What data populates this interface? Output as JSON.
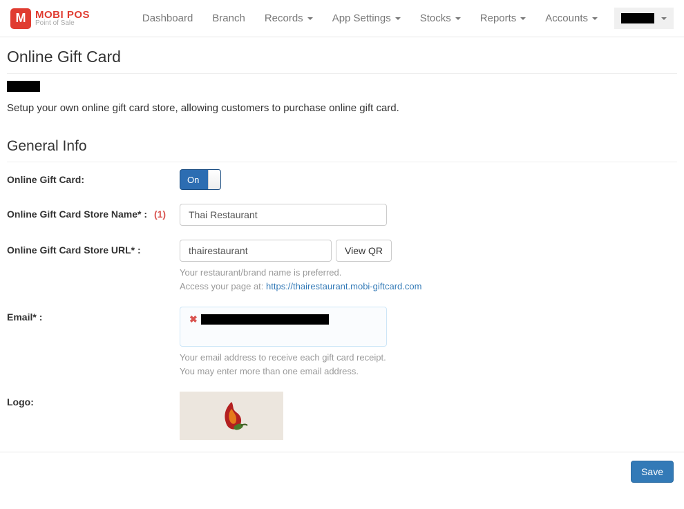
{
  "nav": {
    "logo_title": "MOBI POS",
    "logo_subtitle": "Point of Sale",
    "items": [
      {
        "label": "Dashboard",
        "dropdown": false
      },
      {
        "label": "Branch",
        "dropdown": false
      },
      {
        "label": "Records",
        "dropdown": true
      },
      {
        "label": "App Settings",
        "dropdown": true
      },
      {
        "label": "Stocks",
        "dropdown": true
      },
      {
        "label": "Reports",
        "dropdown": true
      },
      {
        "label": "Accounts",
        "dropdown": true
      }
    ]
  },
  "page": {
    "title": "Online Gift Card",
    "description": "Setup your own online gift card store, allowing customers to purchase online gift card.",
    "section_title": "General Info"
  },
  "form": {
    "toggle": {
      "label": "Online Gift Card:",
      "state": "On"
    },
    "store_name": {
      "label": "Online Gift Card Store Name* :",
      "annotation": "(1)",
      "value": "Thai Restaurant"
    },
    "store_url": {
      "label": "Online Gift Card Store URL* :",
      "value": "thairestaurant",
      "button": "View QR",
      "help_line1": "Your restaurant/brand name is preferred.",
      "help_prefix": "Access your page at: ",
      "help_link": "https://thairestaurant.mobi-giftcard.com"
    },
    "email": {
      "label": "Email* :",
      "help_line1": "Your email address to receive each gift card receipt.",
      "help_line2": "You may enter more than one email address."
    },
    "logo": {
      "label": "Logo:"
    }
  },
  "footer": {
    "save": "Save"
  }
}
